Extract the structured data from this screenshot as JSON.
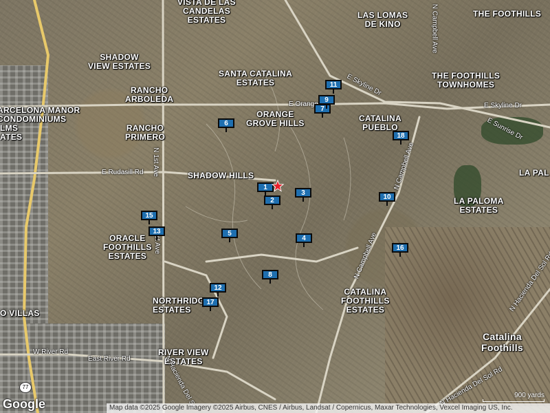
{
  "map": {
    "area_labels": [
      {
        "text": "VISTA DE LAS\nCANDELAS\nESTATES"
      },
      {
        "text": "LAS LOMAS\nDE KINO"
      },
      {
        "text": "THE FOOTHILLS"
      },
      {
        "text": "SHADOW\nVIEW ESTATES"
      },
      {
        "text": "SANTA CATALINA\nESTATES"
      },
      {
        "text": "THE FOOTHILLS\nTOWNHOMES"
      },
      {
        "text": "RANCHO\nARBOLEDA"
      },
      {
        "text": "ARCELONA MANOR\nCONDOMINIUMS"
      },
      {
        "text": "LMS\nATES"
      },
      {
        "text": "ORANGE\nGROVE HILLS"
      },
      {
        "text": "CATALINA\nPUEBLO"
      },
      {
        "text": "RANCHO\nPRIMERO"
      },
      {
        "text": "SHADOW HILLS"
      },
      {
        "text": "LA PAL"
      },
      {
        "text": "LA PALOMA\nESTATES"
      },
      {
        "text": "ORACLE\nFOOTHILLS\nESTATES"
      },
      {
        "text": "CATALINA\nFOOTHILLS\nESTATES"
      },
      {
        "text": "NORTHRIDG\nESTATES"
      },
      {
        "text": "O VILLAS"
      },
      {
        "text": "RIVER VIEW\nESTATES"
      },
      {
        "text": "Catalina\nFoothills"
      }
    ],
    "road_labels": [
      {
        "text": "E Skyline Dr"
      },
      {
        "text": "E Orange G"
      },
      {
        "text": "E Skyline Dr"
      },
      {
        "text": "E Sunrise Dr"
      },
      {
        "text": "E Rudasill Rd"
      },
      {
        "text": "N 1st Ave"
      },
      {
        "text": "N Campbell Ave"
      },
      {
        "text": "N Campbell Ave"
      },
      {
        "text": "N Campbell Ave"
      },
      {
        "text": "W River Rd"
      },
      {
        "text": "East River Rd"
      },
      {
        "text": "N Hacienda Del Sol Rd"
      },
      {
        "text": "N Hacienda Del So"
      },
      {
        "text": "N Hacienda Del Sol Rd"
      },
      {
        "text": "st Ave"
      }
    ],
    "markers": [
      {
        "label": "1"
      },
      {
        "label": "2"
      },
      {
        "label": "3"
      },
      {
        "label": "4"
      },
      {
        "label": "5"
      },
      {
        "label": "6"
      },
      {
        "label": "7"
      },
      {
        "label": "8"
      },
      {
        "label": "9"
      },
      {
        "label": "10"
      },
      {
        "label": "11"
      },
      {
        "label": "12"
      },
      {
        "label": "13"
      },
      {
        "label": "15"
      },
      {
        "label": "16"
      },
      {
        "label": "17"
      },
      {
        "label": "18"
      }
    ],
    "highway_shield": "77",
    "colors": {
      "marker_fill": "#1e6fb0",
      "star": "#e8202a",
      "road": "#d9d4c4"
    }
  },
  "footer": {
    "google_logo": "Google",
    "attribution": "Map data ©2025 Google Imagery ©2025 Airbus, CNES / Airbus, Landsat / Copernicus, Maxar Technologies, Vexcel Imaging US, Inc.",
    "scale": "900 yards"
  }
}
